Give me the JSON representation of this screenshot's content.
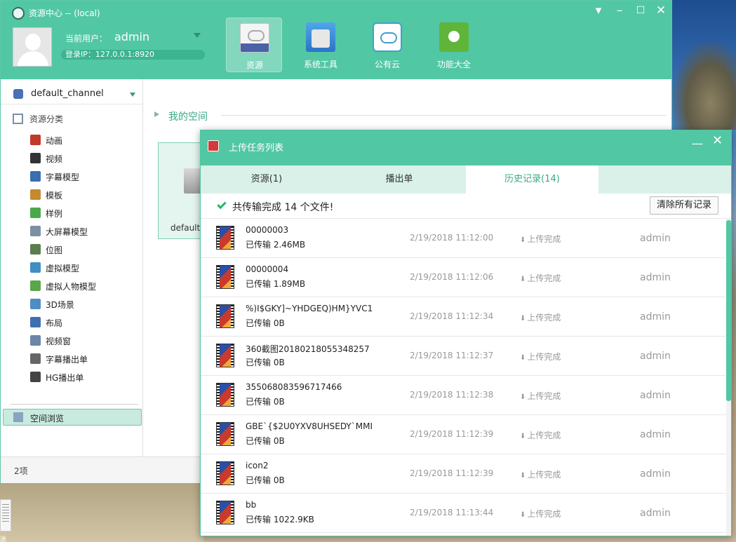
{
  "app": {
    "title": "资源中心 -- (local)",
    "window_controls": [
      "menu-caret",
      "minimize",
      "maximize",
      "close"
    ]
  },
  "user": {
    "label": "当前用户：",
    "name": "admin",
    "login_ip": "登录IP：127.0.0.1:8920"
  },
  "nav": [
    {
      "label": "资源",
      "icon": "resource-drive-icon",
      "active": true
    },
    {
      "label": "系统工具",
      "icon": "system-tools-icon",
      "active": false
    },
    {
      "label": "公有云",
      "icon": "public-cloud-icon",
      "active": false
    },
    {
      "label": "功能大全",
      "icon": "share-functions-icon",
      "active": false
    }
  ],
  "sidebar": {
    "channel": "default_channel",
    "category_header": "资源分类",
    "items": [
      {
        "label": "动画",
        "icon": "animation-icon",
        "color": "#c0392b"
      },
      {
        "label": "视频",
        "icon": "video-clapper-icon",
        "color": "#333333"
      },
      {
        "label": "字幕模型",
        "icon": "subtitle-drop-icon",
        "color": "#3a6fb0"
      },
      {
        "label": "模板",
        "icon": "template-icon",
        "color": "#c48a2f"
      },
      {
        "label": "样例",
        "icon": "sample-puzzle-icon",
        "color": "#4aa84a"
      },
      {
        "label": "大屏幕模型",
        "icon": "monitor-icon",
        "color": "#7d8fa3"
      },
      {
        "label": "位图",
        "icon": "bitmap-icon",
        "color": "#5a7d4e"
      },
      {
        "label": "虚拟模型",
        "icon": "virtual-model-icon",
        "color": "#3f8fc0"
      },
      {
        "label": "虚拟人物模型",
        "icon": "person-icon",
        "color": "#5aa64a"
      },
      {
        "label": "3D场景",
        "icon": "3d-cube-icon",
        "color": "#4e8ec4"
      },
      {
        "label": "布局",
        "icon": "layout-icon",
        "color": "#3f6fb0"
      },
      {
        "label": "视频窗",
        "icon": "video-window-icon",
        "color": "#6b86a8"
      },
      {
        "label": "字幕播出单",
        "icon": "subtitle-playlist-icon",
        "color": "#666666"
      },
      {
        "label": "HG播出单",
        "icon": "headphones-icon",
        "color": "#444444"
      }
    ],
    "space_browse": "空间浏览"
  },
  "content": {
    "title": "我的空间",
    "tile_label": "default_"
  },
  "status_bar": {
    "count": "2项"
  },
  "upload_dialog": {
    "title": "上传任务列表",
    "tabs": [
      {
        "label": "资源(1)",
        "active": false
      },
      {
        "label": "播出单",
        "active": false
      },
      {
        "label": "历史记录(14)",
        "active": true
      }
    ],
    "summary": "共传输完成 14 个文件!",
    "clear_label": "清除所有记录",
    "rows": [
      {
        "name": "00000003",
        "progress": "已传输 2.46MB",
        "time": "2/19/2018 11:12:00",
        "status": "上传完成",
        "user": "admin"
      },
      {
        "name": "00000004",
        "progress": "已传输 1.89MB",
        "time": "2/19/2018 11:12:06",
        "status": "上传完成",
        "user": "admin"
      },
      {
        "name": "%)I$GKY]~YHDGEQ)HM}YVC1",
        "progress": "已传输 0B",
        "time": "2/19/2018 11:12:34",
        "status": "上传完成",
        "user": "admin"
      },
      {
        "name": "360截图20180218055348257",
        "progress": "已传输 0B",
        "time": "2/19/2018 11:12:37",
        "status": "上传完成",
        "user": "admin"
      },
      {
        "name": "355068083596717466",
        "progress": "已传输 0B",
        "time": "2/19/2018 11:12:38",
        "status": "上传完成",
        "user": "admin"
      },
      {
        "name": "GBE`{$2U0YXV8UHSEDY`MMI",
        "progress": "已传输 0B",
        "time": "2/19/2018 11:12:39",
        "status": "上传完成",
        "user": "admin"
      },
      {
        "name": "icon2",
        "progress": "已传输 0B",
        "time": "2/19/2018 11:12:39",
        "status": "上传完成",
        "user": "admin"
      },
      {
        "name": "bb",
        "progress": "已传输 1022.9KB",
        "time": "2/19/2018 11:13:44",
        "status": "上传完成",
        "user": "admin"
      }
    ]
  },
  "desktop": {
    "file_label": "迷"
  }
}
